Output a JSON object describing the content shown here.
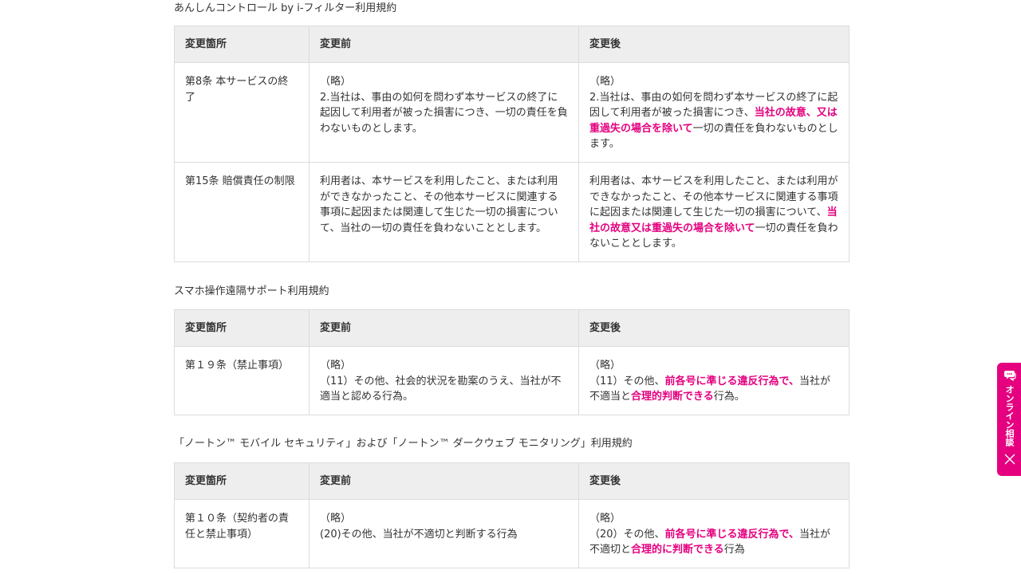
{
  "sections": [
    {
      "title": "あんしんコントロール by i-フィルター利用規約",
      "headers": [
        "変更箇所",
        "変更前",
        "変更後"
      ],
      "rows": [
        {
          "location": [
            "第8条 本サービスの終了"
          ],
          "before": [
            [
              "（略）"
            ],
            [
              "2.当社は、事由の如何を問わず本サービスの終了に起因して利用者が被った損害につき、一切の責任を負わないものとします。"
            ]
          ],
          "after_parts": [
            [
              "（略）"
            ],
            [
              "2.当社は、事由の如何を問わず本サービスの終了に起因して利用者が被った損害につき、",
              "当社の故意、又は重過失の場合を除いて",
              "一切の責任を負わないものとします。"
            ]
          ]
        },
        {
          "location": [
            "第15条 賠償責任の制限"
          ],
          "before": [
            [
              "利用者は、本サービスを利用したこと、または利用ができなかったこと、その他本サービスに関連する事項に起因または関連して生じた一切の損害について、当社の一切の責任を負わないこととします。"
            ]
          ],
          "after_parts": [
            [
              "利用者は、本サービスを利用したこと、または利用ができなかったこと、その他本サービスに関連する事項に起因または関連して生じた一切の損害について、",
              "当社の故意又は重過失の場合を除いて",
              "一切の責任を負わないこととします。"
            ]
          ]
        }
      ]
    },
    {
      "title": "スマホ操作遠隔サポート利用規約",
      "headers": [
        "変更箇所",
        "変更前",
        "変更後"
      ],
      "rows": [
        {
          "location": [
            "第１９条（禁止事項）"
          ],
          "before": [
            [
              "（略）"
            ],
            [
              "（11）その他、社会的状況を勘案のうえ、当社が不適当と認める行為。"
            ]
          ],
          "after_parts": [
            [
              "（略）"
            ],
            [
              "（11）その他、",
              "前各号に準じる違反行為で、",
              "当社が不適当と",
              "合理的判断できる",
              "行為。"
            ]
          ]
        }
      ]
    },
    {
      "title": "「ノートン™ モバイル セキュリティ」および「ノートン™ ダークウェブ モニタリング」利用規約",
      "headers": [
        "変更箇所",
        "変更前",
        "変更後"
      ],
      "rows": [
        {
          "location": [
            "第１０条（契約者の責任と禁止事項）"
          ],
          "before": [
            [
              "（略）"
            ],
            [
              "(20)その他、当社が不適切と判断する行為"
            ]
          ],
          "after_parts": [
            [
              "（略）"
            ],
            [
              "（20）その他、",
              "前各号に準じる違反行為で、",
              "当社が不適切と",
              "合理的に判断できる",
              "行為"
            ]
          ]
        }
      ]
    }
  ],
  "side_tab": {
    "label": "オンライン相談",
    "icon": "chat-icon",
    "close_icon": "close-icon",
    "color": "#e4007f"
  },
  "colors": {
    "highlight": "#e4007f",
    "header_bg": "#eeeeee",
    "border": "#dcdcdc",
    "text": "#333333"
  }
}
